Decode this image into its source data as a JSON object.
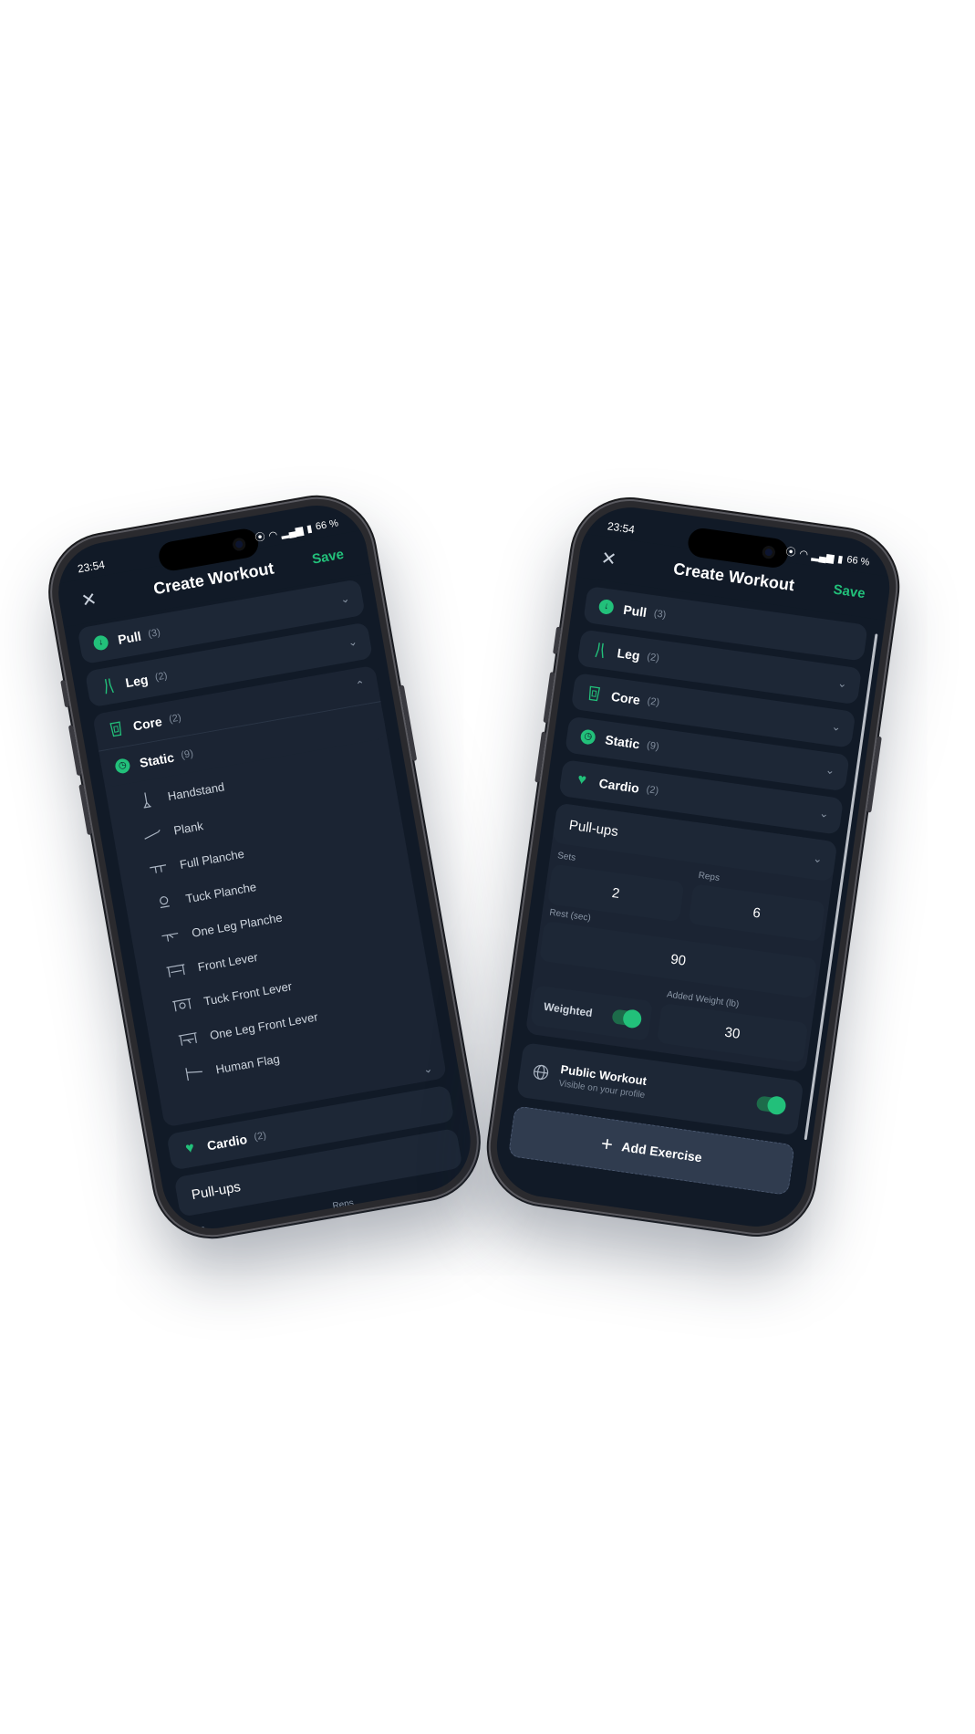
{
  "status": {
    "time": "23:54",
    "battery": "66 %"
  },
  "appbar": {
    "title": "Create Workout",
    "save": "Save"
  },
  "categories": {
    "pull": {
      "name": "Pull",
      "count": "(3)"
    },
    "leg": {
      "name": "Leg",
      "count": "(2)"
    },
    "core": {
      "name": "Core",
      "count": "(2)"
    },
    "static": {
      "name": "Static",
      "count": "(9)"
    },
    "cardio": {
      "name": "Cardio",
      "count": "(2)"
    }
  },
  "static_exercises": [
    "Handstand",
    "Plank",
    "Full Planche",
    "Tuck Planche",
    "One Leg Planche",
    "Front Lever",
    "Tuck Front Lever",
    "One Leg Front Lever",
    "Human Flag"
  ],
  "exercise": {
    "selected": "Pull-ups",
    "sets_label": "Sets",
    "sets": "2",
    "reps_label": "Reps",
    "reps": "6",
    "rest_label": "Rest (sec)",
    "rest": "90",
    "weighted_label": "Weighted",
    "added_weight_label": "Added Weight (lb)",
    "added_weight": "30"
  },
  "public": {
    "title": "Public Workout",
    "subtitle": "Visible on your profile"
  },
  "add_button": "Add Exercise",
  "colors": {
    "accent": "#22c07a",
    "background": "#111a27",
    "card": "#1d2736"
  }
}
